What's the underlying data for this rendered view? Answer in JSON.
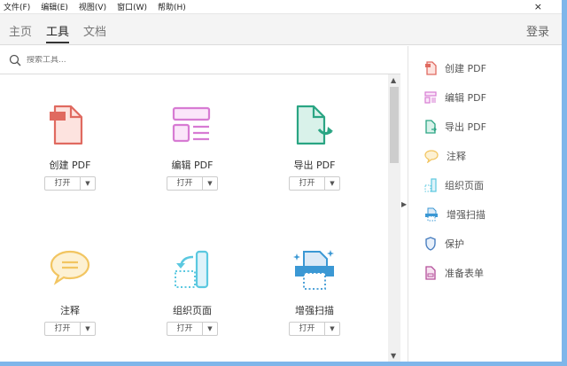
{
  "menu": [
    "文件(F)",
    "编辑(E)",
    "视图(V)",
    "窗口(W)",
    "帮助(H)"
  ],
  "close_glyph": "×",
  "tabs": [
    "主页",
    "工具",
    "文档"
  ],
  "active_tab": "工具",
  "login": "登录",
  "search": {
    "placeholder": "搜索工具..."
  },
  "tools": [
    {
      "label": "创建 PDF",
      "open": "打开",
      "icon": "create-pdf-icon",
      "color": "#e06a60"
    },
    {
      "label": "编辑 PDF",
      "open": "打开",
      "icon": "edit-pdf-icon",
      "color": "#d77bd3"
    },
    {
      "label": "导出 PDF",
      "open": "打开",
      "icon": "export-pdf-icon",
      "color": "#2aa583"
    },
    {
      "label": "注释",
      "open": "打开",
      "icon": "comment-icon",
      "color": "#f2c561"
    },
    {
      "label": "组织页面",
      "open": "打开",
      "icon": "organize-pages-icon",
      "color": "#5bc8e0"
    },
    {
      "label": "增强扫描",
      "open": "打开",
      "icon": "enhance-scan-icon",
      "color": "#3b98d4"
    }
  ],
  "right_panel": [
    {
      "label": "创建 PDF",
      "icon": "create-pdf-icon",
      "color": "#e06a60"
    },
    {
      "label": "编辑 PDF",
      "icon": "edit-pdf-icon",
      "color": "#d77bd3"
    },
    {
      "label": "导出 PDF",
      "icon": "export-pdf-icon",
      "color": "#2aa583"
    },
    {
      "label": "注释",
      "icon": "comment-icon",
      "color": "#f2c561"
    },
    {
      "label": "组织页面",
      "icon": "organize-pages-icon",
      "color": "#5bc8e0"
    },
    {
      "label": "增强扫描",
      "icon": "enhance-scan-icon",
      "color": "#3b98d4"
    },
    {
      "label": "保护",
      "icon": "shield-icon",
      "color": "#4a7fc0"
    },
    {
      "label": "准备表单",
      "icon": "form-icon",
      "color": "#b5509b"
    }
  ]
}
